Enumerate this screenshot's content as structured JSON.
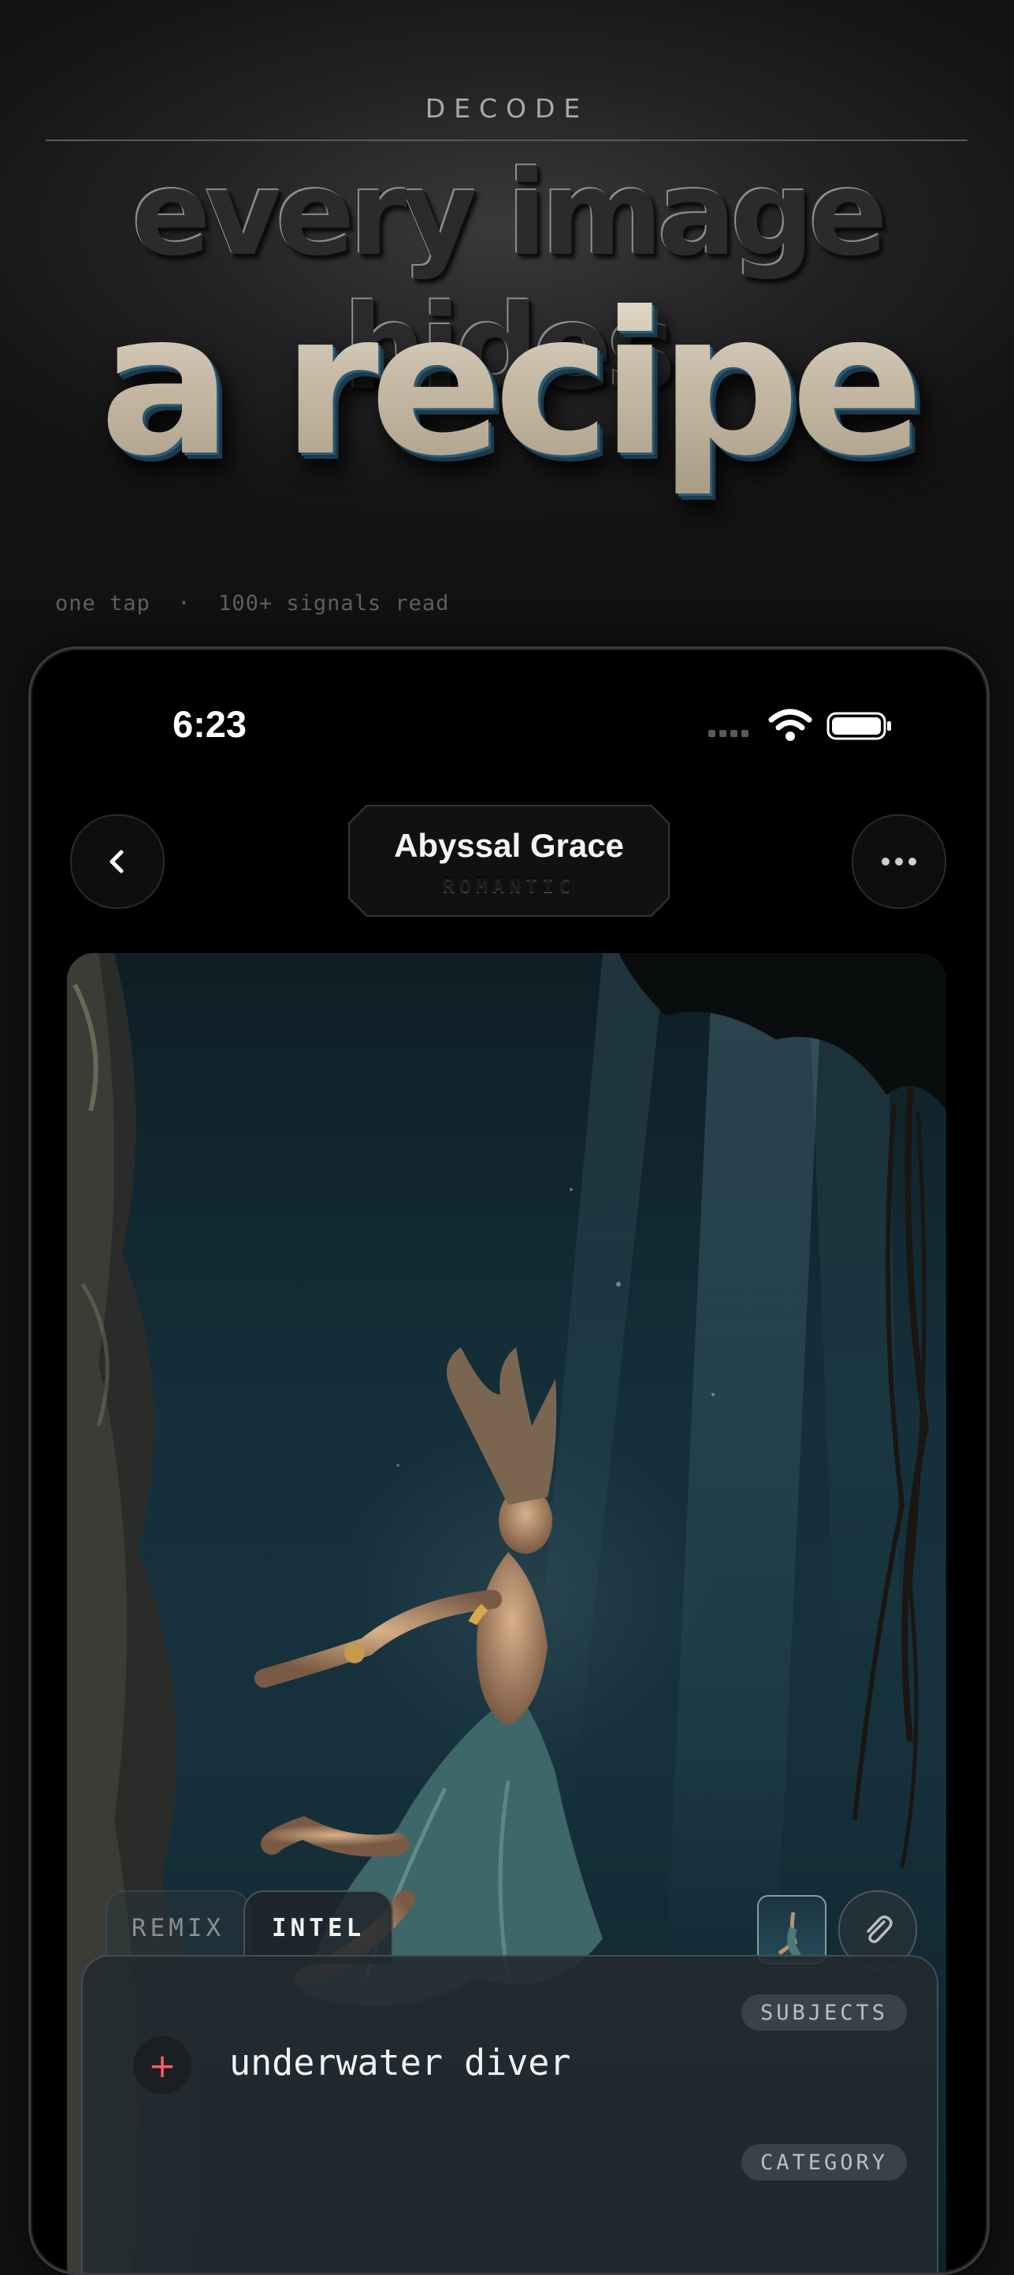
{
  "hero": {
    "eyebrow": "DECODE",
    "line1": "every image hides",
    "line2": "a recipe",
    "caption": "one tap  ·  100+ signals read"
  },
  "status_bar": {
    "time": "6:23",
    "icons": [
      "signal-dots-icon",
      "wifi-icon",
      "battery-icon"
    ]
  },
  "nav": {
    "back_icon": "chevron-left-icon",
    "more_icon": "ellipsis-icon",
    "title": "Abyssal Grace",
    "subtitle": "ROMANTIC"
  },
  "photo": {
    "subject": "underwater diver in flowing dress"
  },
  "tabs": [
    {
      "label": "REMIX",
      "active": false
    },
    {
      "label": "INTEL",
      "active": true
    }
  ],
  "attach_icon": "paperclip-icon",
  "panel": {
    "sections": [
      {
        "pill": "SUBJECTS",
        "add_symbol": "+",
        "value": "underwater diver"
      },
      {
        "pill": "CATEGORY"
      }
    ]
  },
  "colors": {
    "accent_add": "#ff5a6a",
    "hero_metal": "#c9bca6",
    "hero_bevel": "#2e5a72"
  }
}
